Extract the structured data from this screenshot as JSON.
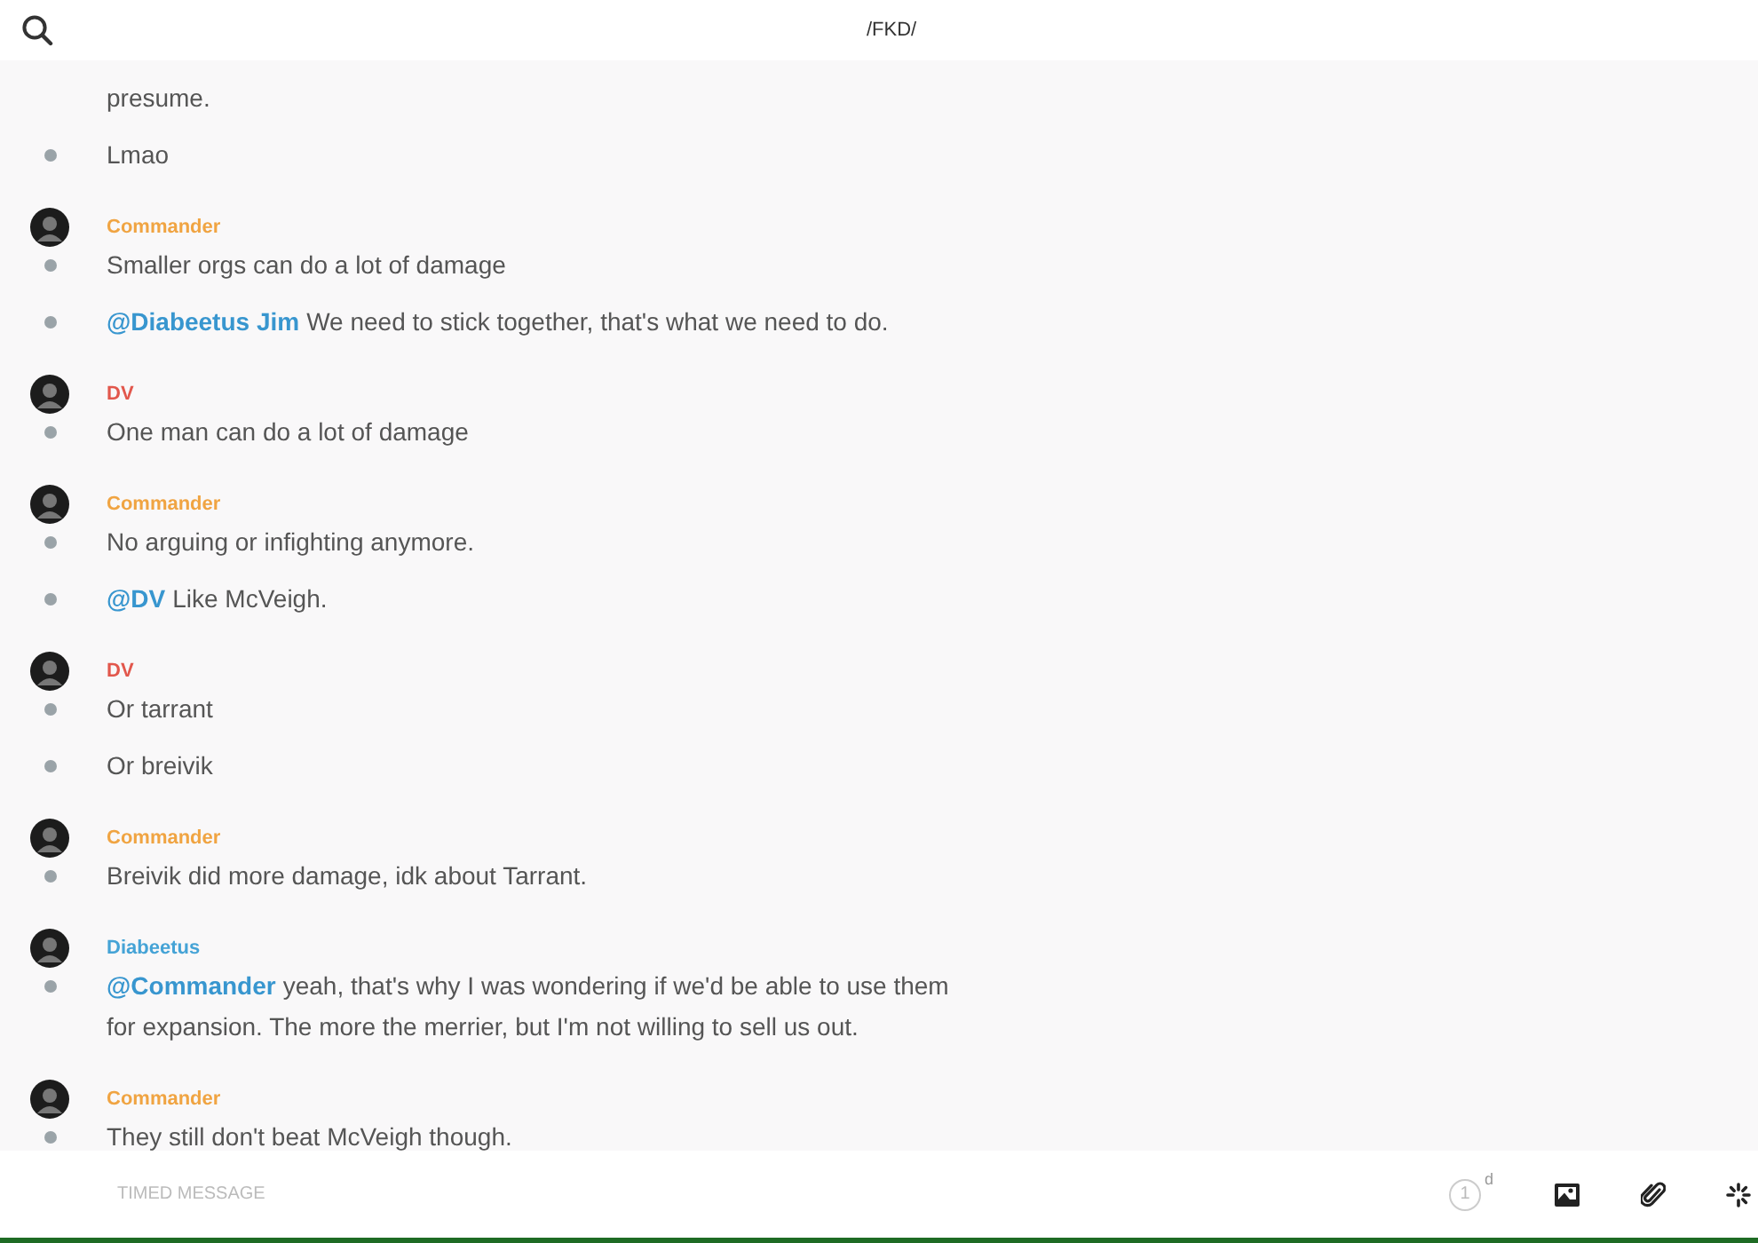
{
  "header": {
    "title": "/FKD/"
  },
  "groups": [
    {
      "messages": [
        {
          "text": "presume.",
          "bullet": false
        },
        {
          "text": "Lmao",
          "bullet": true
        }
      ]
    },
    {
      "author": "Commander",
      "color": "#f0a442",
      "messages": [
        {
          "text": "Smaller orgs can do a lot of damage",
          "bullet": true
        },
        {
          "mention": "@Diabeetus Jim",
          "text": "We need to stick together, that's what we need to do.",
          "bullet": true
        }
      ]
    },
    {
      "author": "DV",
      "color": "#e2574c",
      "messages": [
        {
          "text": "One man can do a lot of damage",
          "bullet": true
        }
      ]
    },
    {
      "author": "Commander",
      "color": "#f0a442",
      "messages": [
        {
          "text": "No arguing or infighting anymore.",
          "bullet": true
        },
        {
          "mention": "@DV",
          "text": "Like McVeigh.",
          "bullet": true
        }
      ]
    },
    {
      "author": "DV",
      "color": "#e2574c",
      "messages": [
        {
          "text": "Or tarrant",
          "bullet": true
        },
        {
          "text": "Or breivik",
          "bullet": true
        }
      ]
    },
    {
      "author": "Commander",
      "color": "#f0a442",
      "messages": [
        {
          "text": "Breivik did more damage, idk about Tarrant.",
          "bullet": true
        }
      ]
    },
    {
      "author": "Diabeetus",
      "color": "#45a3d6",
      "messages": [
        {
          "mention": "@Commander",
          "text": "yeah, that's why I was wondering if we'd be able to use them for expansion. The more the merrier, but I'm not willing to sell us out.",
          "bullet": true
        }
      ]
    },
    {
      "author": "Commander",
      "color": "#f0a442",
      "messages": [
        {
          "text": "They still don't beat McVeigh though.",
          "bullet": true
        }
      ]
    }
  ],
  "composer": {
    "placeholder": "TIMED MESSAGE",
    "timer": "1",
    "timer_unit": "d"
  }
}
